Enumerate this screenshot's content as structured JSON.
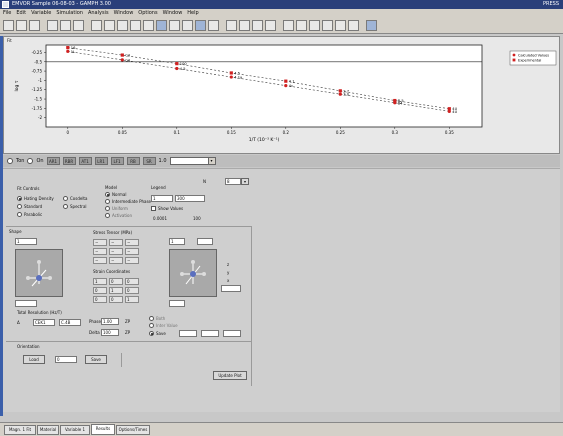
{
  "window": {
    "title": "EMVOR Sample 06-08-03 - GAMPH 3.00",
    "right_label": "PRESS"
  },
  "menu": [
    "File",
    "Edit",
    "Variable",
    "Simulation",
    "Analysis",
    "Window",
    "Options",
    "Window",
    "Help"
  ],
  "chart_panel": {
    "label": "Fit",
    "legend": [
      "Calculated Values",
      "Experimental"
    ]
  },
  "chart_data": {
    "type": "scatter",
    "xlabel": "1/T (10⁻³ K⁻¹)",
    "ylabel": "log τ",
    "xlim": [
      -0.02,
      0.38
    ],
    "ylim": [
      -2.25,
      -0.05
    ],
    "xticks": [
      "0",
      "0.05",
      "0.1",
      "0.15",
      "0.2",
      "0.25",
      "0.3",
      "0.35"
    ],
    "yticks": [
      "-0.25",
      "-0.5",
      "-0.75",
      "-1",
      "-1.25",
      "-1.5",
      "-1.75",
      "-2"
    ],
    "series": [
      {
        "name": "Calculated Values",
        "x": [
          0.0,
          0.05,
          0.1,
          0.15,
          0.2,
          0.25,
          0.3,
          0.35
        ],
        "y": [
          -0.22,
          -0.45,
          -0.68,
          -0.91,
          -1.14,
          -1.37,
          -1.6,
          -1.83
        ],
        "labels": [
          "1L",
          "C4",
          "4.5",
          "4.1a",
          "4c",
          "3.0",
          "B4",
          "4U"
        ]
      },
      {
        "name": "Experimental",
        "x": [
          0.0,
          0.05,
          0.1,
          0.15,
          0.2,
          0.25,
          0.3,
          0.35
        ],
        "y": [
          -0.12,
          -0.32,
          -0.55,
          -0.8,
          -1.02,
          -1.28,
          -1.54,
          -1.76
        ],
        "labels": [
          "16",
          "C4",
          "100",
          "4.5",
          "4.1",
          "2.7",
          "B.5",
          "4U"
        ]
      }
    ],
    "grid": false,
    "legend_position": "right"
  },
  "controls": {
    "first_radio": "Ton",
    "second_radio": "On",
    "buttons": [
      "AR1",
      "RBR",
      "AT1",
      "LR1",
      "LF1",
      "RB",
      "SR"
    ],
    "range_value": "1.0",
    "count_value": "8"
  },
  "fit_controls": {
    "label": "Fit Controls",
    "options": [
      "Hating Density",
      "Standard",
      "Parabolic",
      "Cosdelta",
      "Spectral"
    ],
    "analysis_label": "Model",
    "analysis_options": [
      "Normal",
      "Intermediate Phase",
      "Uniform",
      "Activation"
    ],
    "legend_label": "Legend",
    "legend_field": "1",
    "legend_value": "300",
    "legend_check": "Show Values",
    "tolerance": "0.0001",
    "iterations": "100"
  },
  "structure": {
    "label": "Shape",
    "left_field": "1",
    "right_field": "1",
    "matrix_label": "Stress Tensor (MPa)",
    "matrix": [
      [
        "−",
        "−",
        "−"
      ],
      [
        "−",
        "−",
        "−"
      ],
      [
        "−",
        "−",
        "−"
      ]
    ],
    "strain_label": "Strain Coordinates",
    "strain": [
      [
        "1",
        "0",
        "0"
      ],
      [
        "0",
        "1",
        "0"
      ],
      [
        "0",
        "0",
        "1"
      ]
    ],
    "side_labels": [
      "z",
      "y",
      "x"
    ]
  },
  "resolution": {
    "label": "Total Resolution (Hz/T)",
    "left": "CEK1",
    "right": "C.4B",
    "phase_label": "Phase",
    "phase_value": "1.00",
    "delta_label": "Delta",
    "delta_value": "100",
    "phase_option": "ZP",
    "delta_option": "ZP",
    "right_opts": [
      "Both",
      "Inter Value",
      "Save"
    ]
  },
  "orientation": {
    "label": "Orientation",
    "fields": [
      "Load",
      "0",
      "Save"
    ]
  },
  "update_button": "Update Plot",
  "tabs": [
    "Magn. 1 Fit",
    "Material",
    "Variable 1",
    "Results",
    "Options/Times"
  ],
  "active_tab": 3
}
